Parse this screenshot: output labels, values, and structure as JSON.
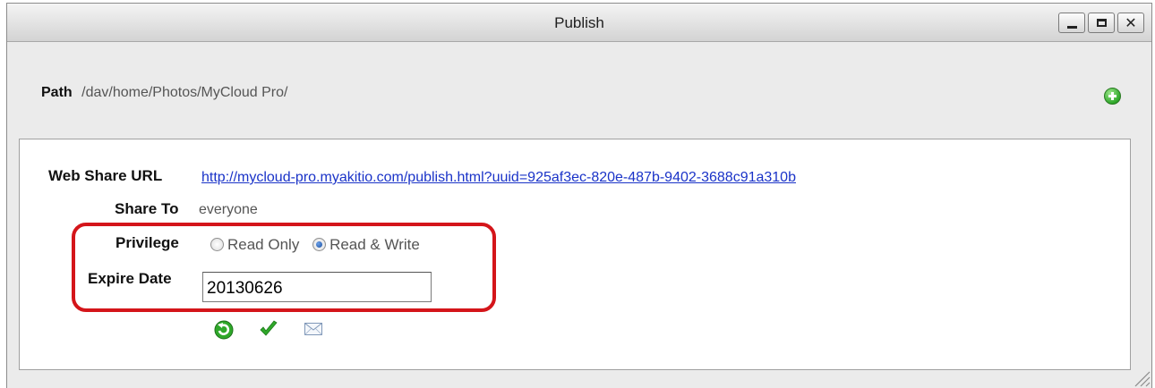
{
  "window": {
    "title": "Publish"
  },
  "path": {
    "label": "Path",
    "value": "/dav/home/Photos/MyCloud Pro/"
  },
  "share": {
    "url_label": "Web Share URL",
    "url": "http://mycloud-pro.myakitio.com/publish.html?uuid=925af3ec-820e-487b-9402-3688c91a310b",
    "share_to_label": "Share To",
    "share_to_value": "everyone",
    "privilege_label": "Privilege",
    "privilege_options": [
      "Read Only",
      "Read & Write"
    ],
    "privilege_selected": "Read & Write",
    "expire_label": "Expire Date",
    "expire_value": "20130626"
  },
  "icons": {
    "add": "add-icon",
    "refresh": "refresh-icon",
    "confirm": "checkmark-icon",
    "email": "envelope-icon"
  },
  "colors": {
    "highlight": "#d4151a",
    "link": "#1a33c8",
    "success_green": "#2fa82a"
  }
}
